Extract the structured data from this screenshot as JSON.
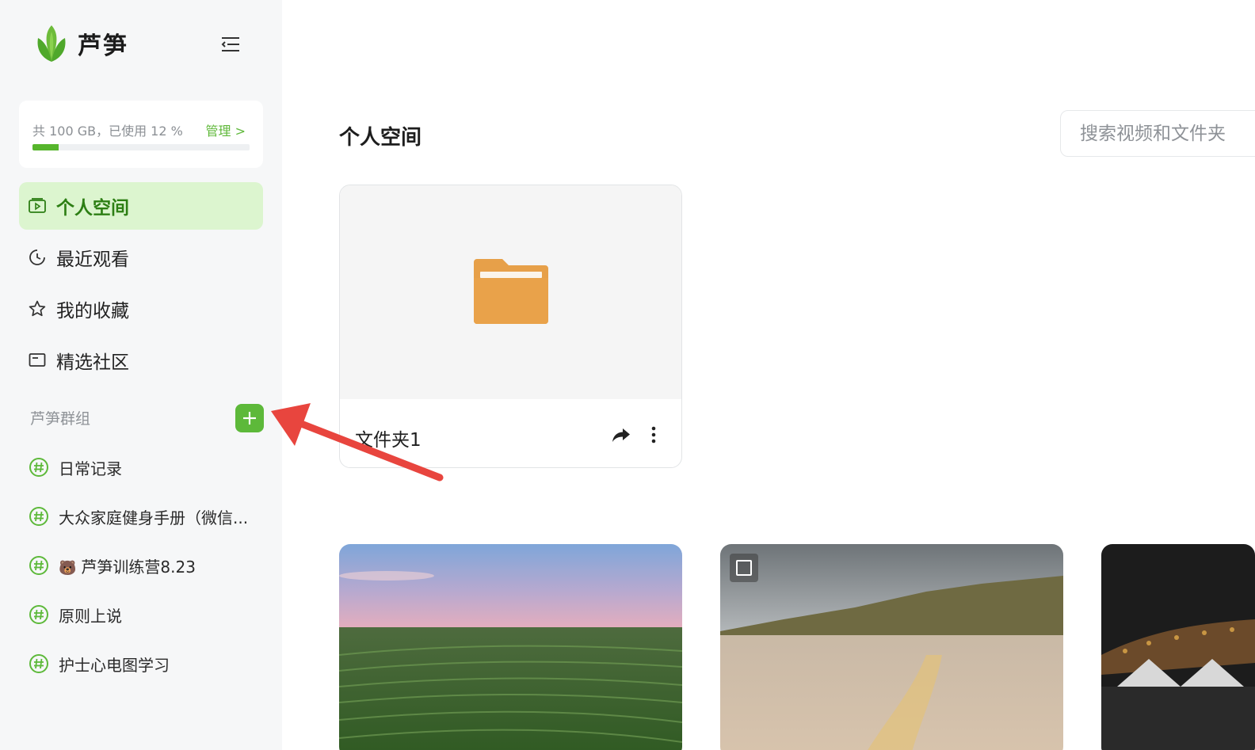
{
  "app": {
    "name": "芦笋",
    "brand_color": "#5db93a"
  },
  "storage": {
    "text": "共 100 GB，已使用 12 %",
    "used_percent": 12,
    "manage_label": "管理 >"
  },
  "nav": [
    {
      "label": "个人空间",
      "icon": "video-folder-icon",
      "active": true
    },
    {
      "label": "最近观看",
      "icon": "clock-icon",
      "active": false
    },
    {
      "label": "我的收藏",
      "icon": "star-icon",
      "active": false
    },
    {
      "label": "精选社区",
      "icon": "window-icon",
      "active": false
    }
  ],
  "groups": {
    "header": "芦笋群组",
    "items": [
      {
        "label": "日常记录"
      },
      {
        "label": "大众家庭健身手册（微信..."
      },
      {
        "emoji": "🐻",
        "label": "芦笋训练营8.23"
      },
      {
        "label": "原则上说"
      },
      {
        "label": "护士心电图学习"
      }
    ]
  },
  "main": {
    "title": "个人空间",
    "search_placeholder": "搜索视频和文件夹",
    "folder": {
      "name": "文件夹1"
    }
  }
}
